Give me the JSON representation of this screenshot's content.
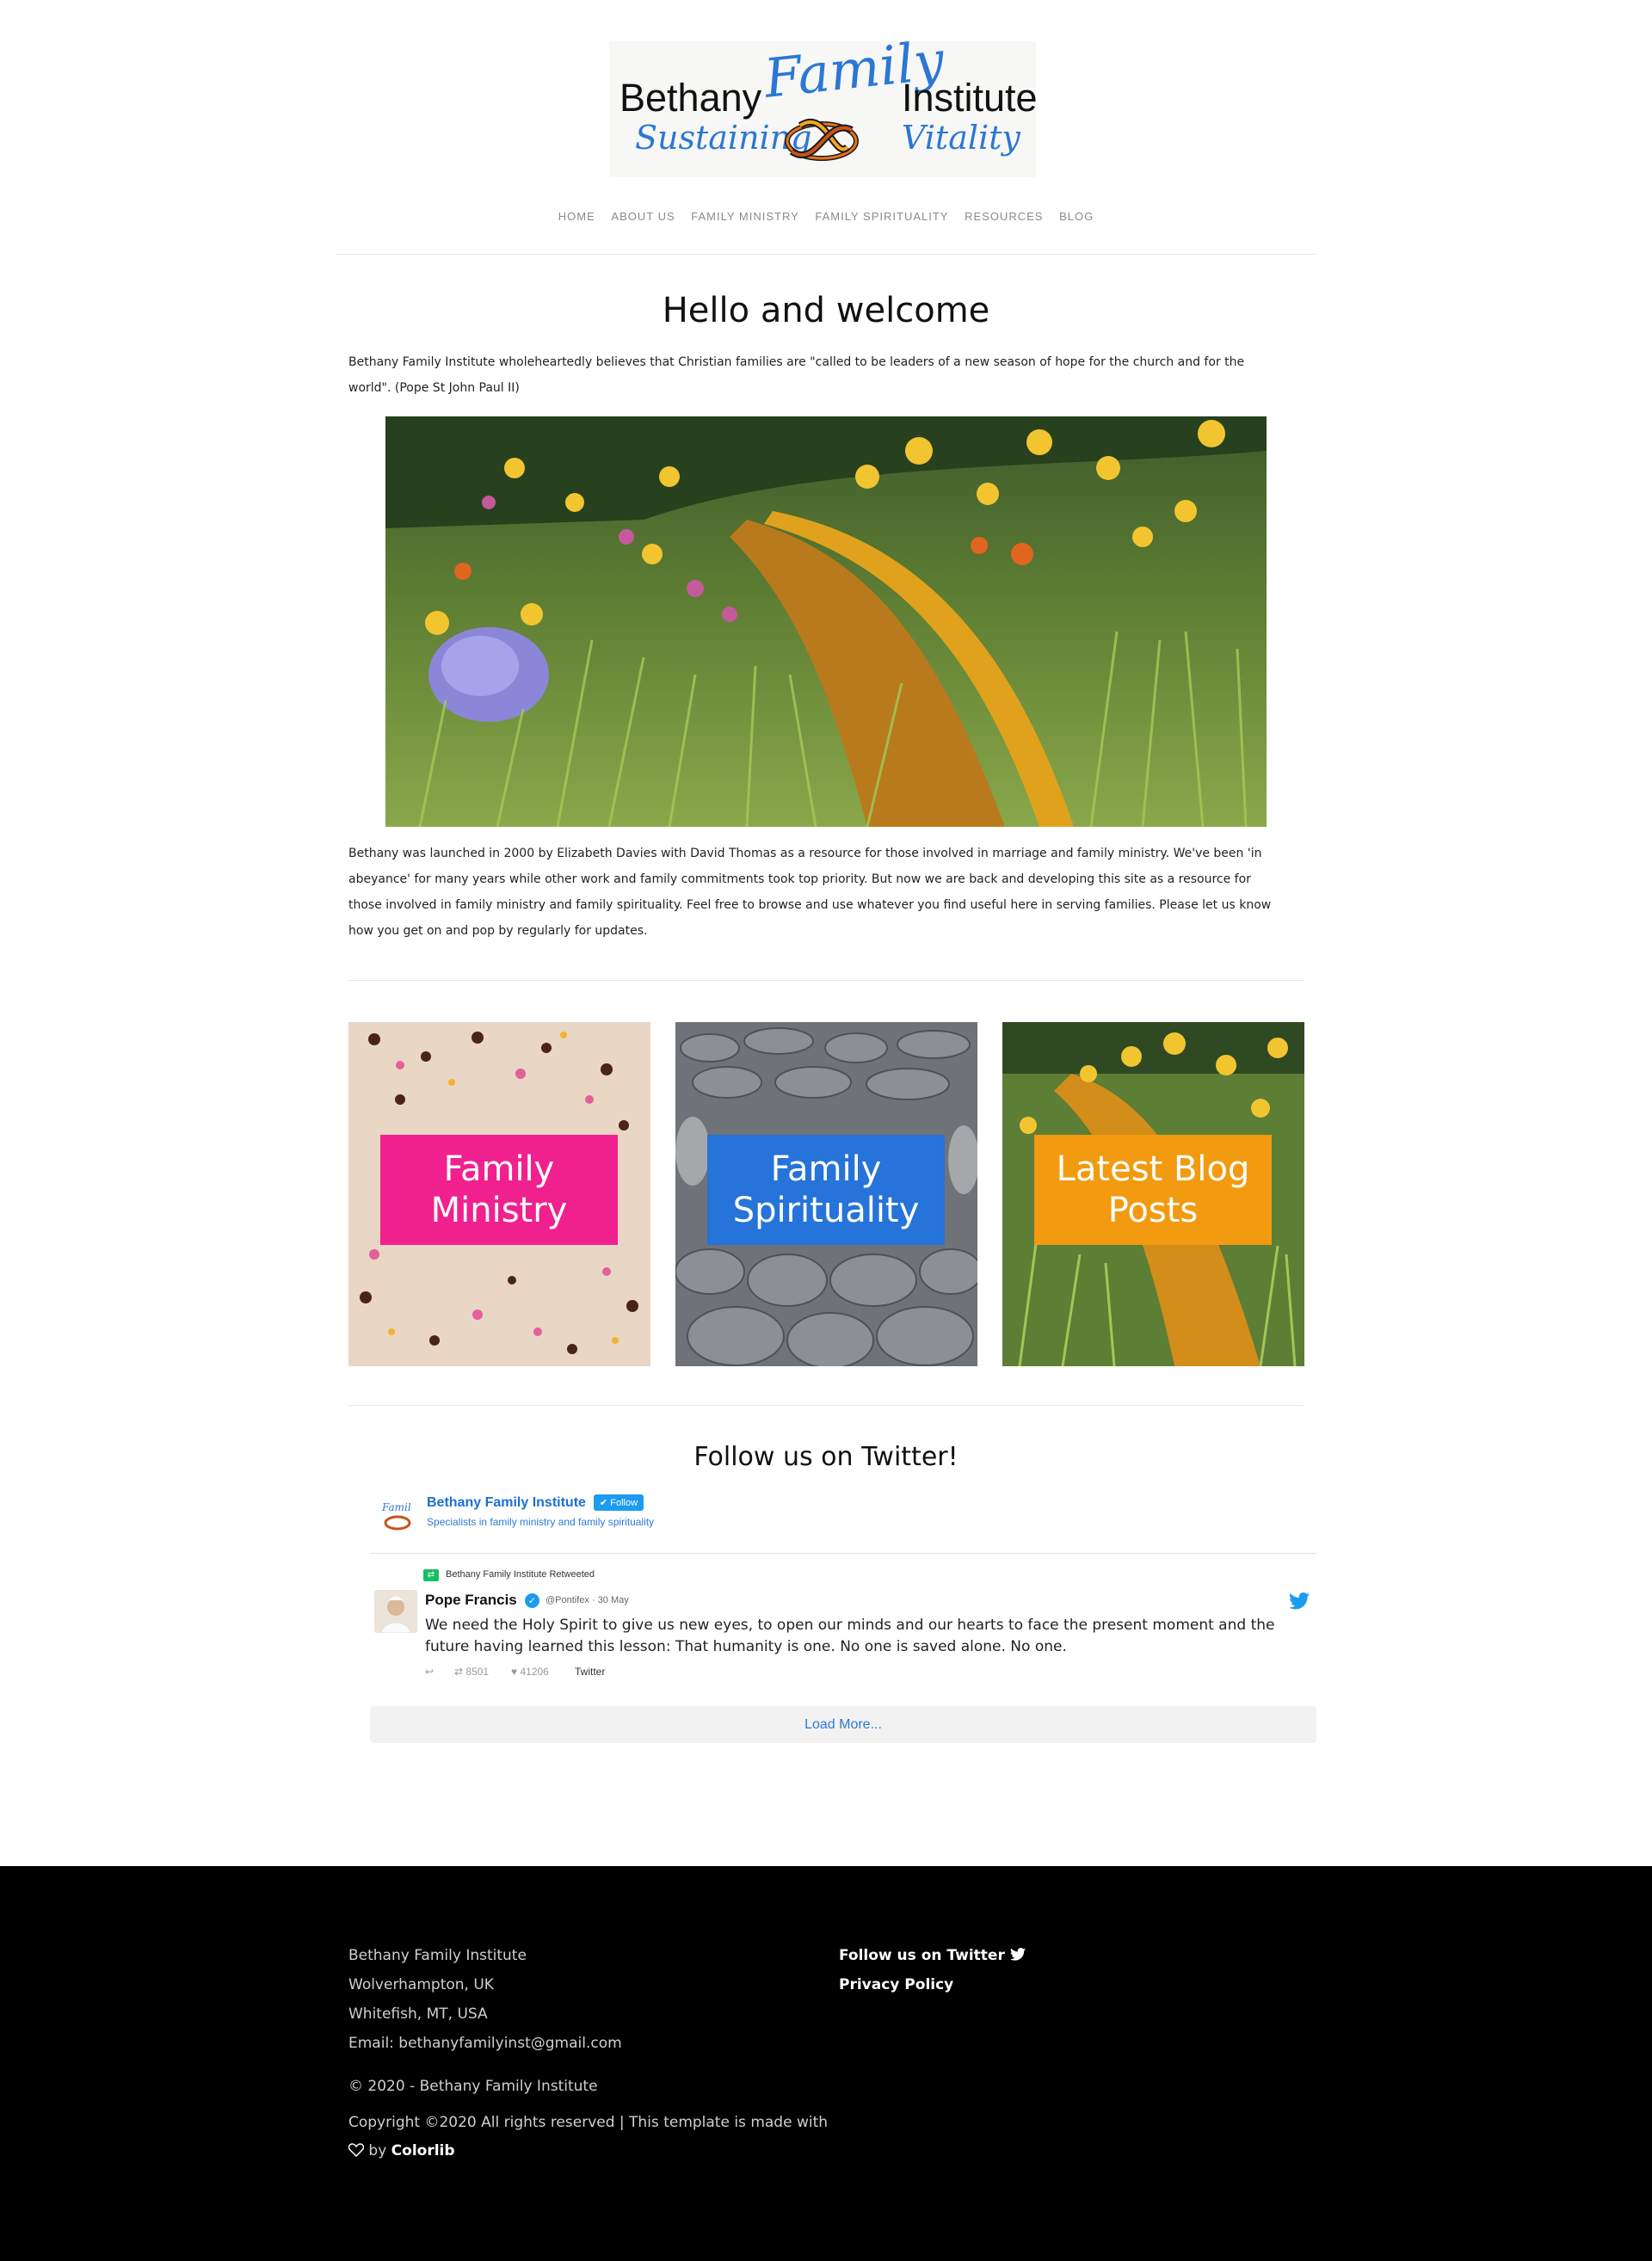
{
  "logo": {
    "word1": "Bethany",
    "word2": "Family",
    "word3": "Institute",
    "word4": "Sustaining",
    "word5": "Vitality"
  },
  "nav": {
    "items": [
      "HOME",
      "ABOUT US",
      "FAMILY MINISTRY",
      "FAMILY SPIRITUALITY",
      "RESOURCES",
      "BLOG"
    ]
  },
  "main": {
    "title": "Hello and welcome",
    "intro_line1": "Bethany Family Institute wholeheartedly believes that Christian families are \"called to be leaders of a new season of hope for the church and for the",
    "intro_line2": "world\".  (Pope St John Paul II)",
    "about_line1": "Bethany was launched in 2000 by Elizabeth Davies with David Thomas as a resource for those involved in marriage and family ministry. We've been 'in",
    "about_line2": "abeyance' for many years while other work and family commitments took top priority. But now we are back and developing this site as a resource for",
    "about_line3": "those involved in family ministry and family spirituality. Feel free to browse and use whatever you find useful here in serving families. Please let us know",
    "about_line4": "how you get on and pop by regularly for updates."
  },
  "cards": [
    {
      "line1": "Family",
      "line2": "Ministry",
      "color": "#f0218e"
    },
    {
      "line1": "Family",
      "line2": "Spirituality",
      "color": "#2673d9"
    },
    {
      "line1": "Latest Blog",
      "line2": "Posts",
      "color": "#f29b10"
    }
  ],
  "twitter": {
    "heading": "Follow us on Twitter!",
    "account_name": "Bethany Family Institute",
    "follow_label": "Follow",
    "account_desc": "Specialists in family ministry and family spirituality",
    "retweeted_by": "Bethany Family Institute Retweeted",
    "tweet": {
      "author": "Pope Francis",
      "handle": "@Pontifex · 30 May",
      "text": "We need the Holy Spirit to give us new eyes, to open our minds and our hearts to face the present moment and the future having learned this lesson: That humanity is one. No one is saved alone. No one.",
      "retweets": "8501",
      "likes": "41206",
      "source": "Twitter"
    },
    "load_more": "Load More..."
  },
  "footer": {
    "org": "Bethany Family Institute",
    "loc1": "Wolverhampton, UK",
    "loc2": "Whitefish, MT, USA",
    "email": "Email: bethanyfamilyinst@gmail.com",
    "copyright": "© 2020 - Bethany Family Institute",
    "template_line1": "Copyright ©2020 All rights reserved | This template is made with",
    "by": "by",
    "colorlib": "Colorlib",
    "follow_twitter": "Follow us on Twitter",
    "privacy": "Privacy Policy"
  }
}
